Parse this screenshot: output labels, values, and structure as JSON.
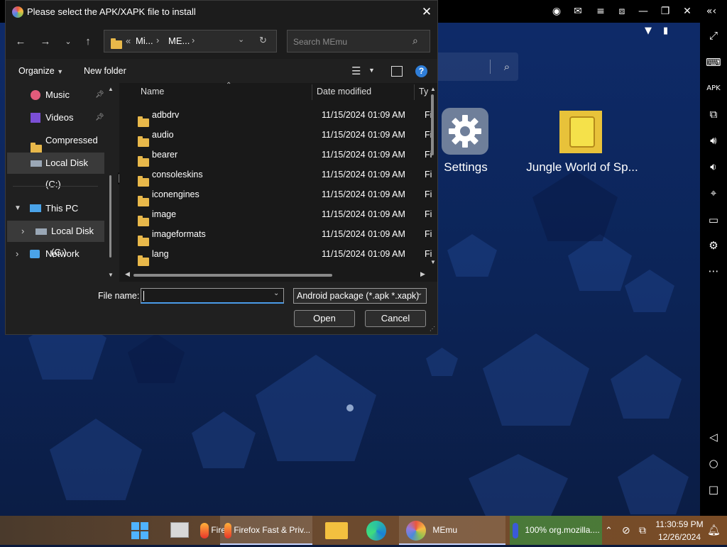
{
  "emulator": {
    "apps": [
      {
        "label": "Settings"
      },
      {
        "label": "Jungle World of Sp..."
      }
    ]
  },
  "dialog": {
    "title": "Please select the APK/XAPK file to install",
    "address": {
      "part1": "Mi...",
      "part2": "ME...",
      "prefix": "«"
    },
    "search_placeholder": "Search MEmu",
    "organize_label": "Organize",
    "new_folder_label": "New folder",
    "nav_items": [
      {
        "label": "Music"
      },
      {
        "label": "Videos"
      },
      {
        "label": "Compressed"
      },
      {
        "label": "Local Disk (C:)"
      },
      {
        "label": "This PC"
      },
      {
        "label": "Local Disk (C:)"
      },
      {
        "label": "Network"
      }
    ],
    "columns": {
      "name": "Name",
      "date": "Date modified",
      "type": "Ty"
    },
    "files": [
      {
        "name": "adbdrv",
        "date": "11/15/2024 01:09 AM",
        "type": "Fi"
      },
      {
        "name": "audio",
        "date": "11/15/2024 01:09 AM",
        "type": "Fi"
      },
      {
        "name": "bearer",
        "date": "11/15/2024 01:09 AM",
        "type": "Fi"
      },
      {
        "name": "consoleskins",
        "date": "11/15/2024 01:09 AM",
        "type": "Fi"
      },
      {
        "name": "iconengines",
        "date": "11/15/2024 01:09 AM",
        "type": "Fi"
      },
      {
        "name": "image",
        "date": "11/15/2024 01:09 AM",
        "type": "Fi"
      },
      {
        "name": "imageformats",
        "date": "11/15/2024 01:09 AM",
        "type": "Fi"
      },
      {
        "name": "lang",
        "date": "11/15/2024 01:09 AM",
        "type": "Fi"
      }
    ],
    "file_name_label": "File name:",
    "file_name_value": "",
    "file_type": "Android package (*.apk *.xapk)",
    "open_label": "Open",
    "cancel_label": "Cancel"
  },
  "taskbar": {
    "firefox_short": "Fire",
    "firefox_title": "Firefox Fast & Priv...",
    "memu_title": "MEmu",
    "download_title": "100% org.mozilla....",
    "time": "11:30:59 PM",
    "date": "12/26/2024"
  },
  "colors": {
    "accent": "#0078d4",
    "folder": "#e8b84a"
  }
}
